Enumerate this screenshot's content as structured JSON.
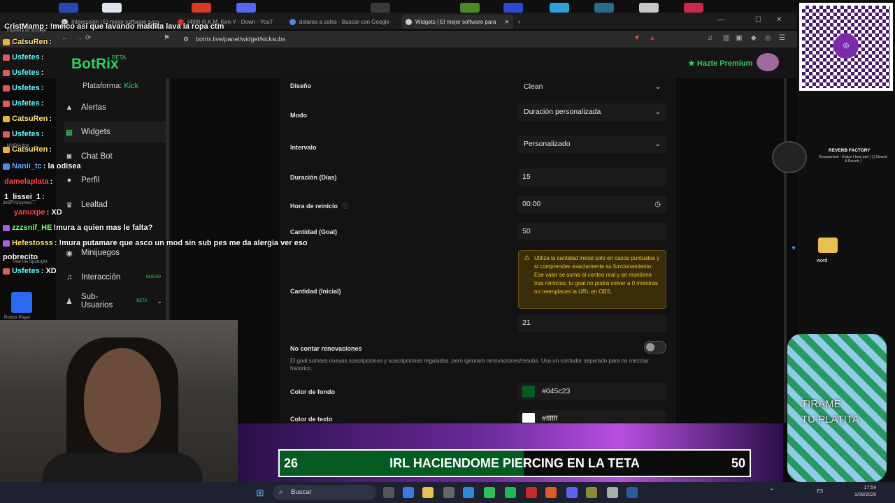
{
  "browser": {
    "tabs": [
      {
        "label": "Interacción | El mejor software para"
      },
      {
        "label": "(498) R.K.M, Ken-Y - Down - YouT"
      },
      {
        "label": "dolares a soles - Buscar con Google"
      },
      {
        "label": "Widgets | El mejor software para"
      }
    ],
    "url": "botrix.live/panel/widget/kicksubs"
  },
  "app": {
    "logo": "BotRix",
    "logo_badge": "BETA",
    "premium": "★ Hazte Premium"
  },
  "sidebar": {
    "platform_label": "Plataforma:",
    "platform_value": "Kick",
    "items": [
      {
        "label": "Alertas",
        "icon": "alert-icon"
      },
      {
        "label": "Widgets",
        "icon": "grid-icon"
      },
      {
        "label": "Chat Bot",
        "icon": "bot-icon"
      },
      {
        "label": "Perfil",
        "icon": "user-icon"
      },
      {
        "label": "Lealtad",
        "icon": "trophy-icon"
      },
      {
        "label": "Minijuegos",
        "icon": "gamepad-icon"
      },
      {
        "label": "Interacción",
        "icon": "music-icon",
        "badge": "NUEVO"
      },
      {
        "label": "Sub-Usuarios",
        "icon": "users-icon",
        "badge": "BETA"
      }
    ]
  },
  "form": {
    "diseno_label": "Diseño",
    "diseno_value": "Clean",
    "modo_label": "Modo",
    "modo_value": "Duración personalizada",
    "intervalo_label": "Intervalo",
    "intervalo_value": "Personalizado",
    "duracion_label": "Duración (Días)",
    "duracion_value": "15",
    "hora_label": "Hora de reinicio",
    "hora_value": "00:00",
    "goal_label": "Cantidad (Goal)",
    "goal_value": "50",
    "inicial_label": "Cantidad (Inicial)",
    "inicial_warning": "Utiliza la cantidad inicial solo en casos puntuales y si comprendes exactamente su funcionamiento. Ese valor se suma al conteo real y se mantiene tras reinicios; tu goal no podrá volver a 0 mientras no reemplaces la URL en OBS.",
    "inicial_value": "21",
    "renovaciones_label": "No contar renovaciones",
    "renovaciones_help": "El goal sumara nuevas suscripciones y suscripciones regaladas, pero ignorara renovaciones/resubs. Usa un contador separado para no mezclar historico.",
    "fondo_label": "Color de fondo",
    "fondo_value": "#045c23",
    "texto_label": "Color de texto",
    "texto_value": "#ffffff"
  },
  "chat": [
    {
      "user": "CristMamp",
      "msg": ": !meico asi que lavando maldita lava la ropa ctm",
      "color": "#ffffff"
    },
    {
      "user": "CatsuRen",
      "msg": ":",
      "color": "#ffe27a"
    },
    {
      "user": "Usfetes",
      "msg": ":",
      "color": "#6ff"
    },
    {
      "user": "Usfetes",
      "msg": ":",
      "color": "#6ff"
    },
    {
      "user": "Usfetes",
      "msg": ":",
      "color": "#6ff"
    },
    {
      "user": "Usfetes",
      "msg": ":",
      "color": "#6ff"
    },
    {
      "user": "CatsuRen",
      "msg": ":",
      "color": "#ffe27a"
    },
    {
      "user": "Usfetes",
      "msg": ":",
      "color": "#6ff"
    },
    {
      "user": "CatsuRen",
      "msg": ":",
      "color": "#ffe27a"
    },
    {
      "user": "Nanii_tc",
      "msg": ": la odisea",
      "color": "#6aa8ff"
    },
    {
      "user": "damelaplata",
      "msg": ":",
      "color": "#ff4a4a"
    },
    {
      "user": "1_lissei_1",
      "msg": ":",
      "color": "#ffffff"
    },
    {
      "user": "yanuxpe",
      "msg": ": XD",
      "color": "#ff4a4a"
    },
    {
      "user": "zzzsnif_HE",
      "msg": "!mura a quien mas le falta?",
      "color": "#7dff7d"
    },
    {
      "user": "Hefestosss",
      "msg": ": !mura putamare que asco un mod sin sub pes me da alergia ver eso",
      "color": "#ffe27a"
    },
    {
      "user": "pobrecito",
      "msg": "",
      "color": "#ffffff"
    },
    {
      "user": "Usfetes",
      "msg": ": XD",
      "color": "#6ff"
    }
  ],
  "goal_bar": {
    "current": "26",
    "title": "IRL HACIENDOME PIERCING EN LA TETA",
    "target": "50",
    "fill_fraction": 0.52,
    "fill_color": "#045c23"
  },
  "desktop": {
    "reverb_title": "REVERB FACTORY",
    "reverb_sub": "Grausamkeit - Kratze ( best part ) | [ Slowed & Reverb ]",
    "jar_text_1": "TIRAME",
    "jar_text_2": "TU PLATITA",
    "folder_label": "word",
    "desk_label_1": "Papelera de reciclaje",
    "desk_label_2": "NVIDIA App",
    "desk_label_3": "2invPY2UyHori...",
    "desk_label_4": "Fear the SpotLight",
    "desk_label_5": "Roblox Player"
  },
  "taskbar": {
    "search_placeholder": "Buscar",
    "time": "17:54",
    "date": "1/08/2026"
  }
}
